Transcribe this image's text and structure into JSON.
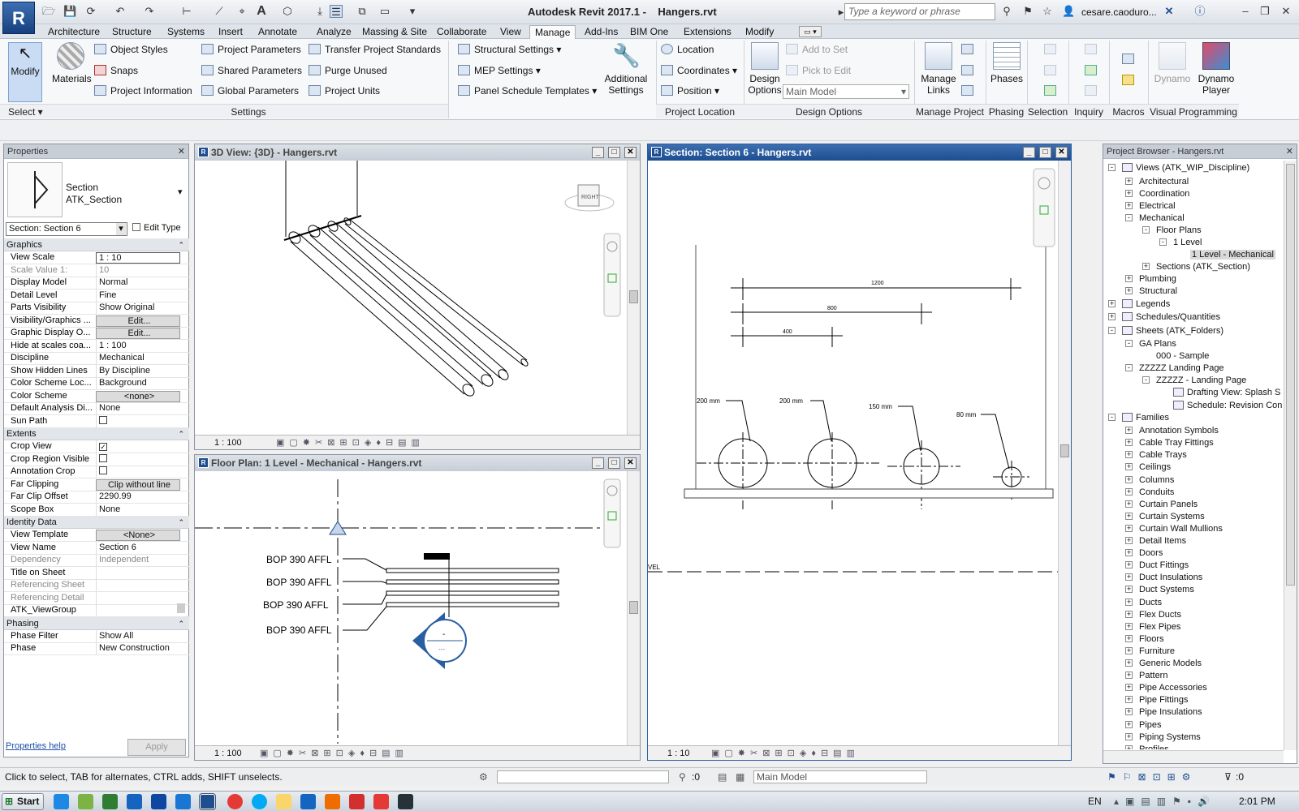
{
  "app": {
    "logo": "R",
    "title": "Autodesk Revit 2017.1 -    Hangers.rvt",
    "search_placeholder": "Type a keyword or phrase",
    "user": "cesare.caoduro..."
  },
  "tabs": [
    "Architecture",
    "Structure",
    "Systems",
    "Insert",
    "Annotate",
    "Analyze",
    "Massing & Site",
    "Collaborate",
    "View",
    "Manage",
    "Add-Ins",
    "BIM One",
    "Extensions",
    "Modify"
  ],
  "active_tab": "Manage",
  "ribbon": {
    "modify_label": "Modify",
    "materials_label": "Materials",
    "settings_col1": [
      "Object  Styles",
      "Snaps",
      "Project  Information"
    ],
    "settings_col2": [
      "Project  Parameters",
      "Shared  Parameters",
      "Global  Parameters"
    ],
    "settings_col3": [
      "Transfer  Project Standards",
      "Purge  Unused",
      "Project  Units"
    ],
    "mep_col": [
      "Structural  Settings",
      "MEP  Settings",
      "Panel Schedule  Templates"
    ],
    "additional_settings": "Additional Settings",
    "location_col": [
      "Location",
      "Coordinates",
      "Position"
    ],
    "design_options_label": "Design Options",
    "add_to_set": "Add to Set",
    "pick_to_edit": "Pick to Edit",
    "main_model": "Main Model",
    "manage_links": "Manage Links",
    "phases": "Phases",
    "dynamo": "Dynamo",
    "dynamo_player": "Dynamo Player",
    "panels": [
      "Select",
      "Settings",
      "Project Location",
      "Design Options",
      "Manage Project",
      "Phasing",
      "Selection",
      "Inquiry",
      "Macros",
      "Visual Programming"
    ]
  },
  "properties": {
    "title": "Properties",
    "type_name": "Section",
    "type_sub": "ATK_Section",
    "instance_selector": "Section: Section 6",
    "edit_type": "Edit Type",
    "groups": {
      "graphics": "Graphics",
      "extents": "Extents",
      "identity": "Identity Data",
      "phasing": "Phasing"
    },
    "graphics_rows": [
      [
        "View Scale",
        "1 : 10"
      ],
      [
        "Scale Value    1:",
        "10"
      ],
      [
        "Display Model",
        "Normal"
      ],
      [
        "Detail Level",
        "Fine"
      ],
      [
        "Parts Visibility",
        "Show Original"
      ],
      [
        "Visibility/Graphics ...",
        "Edit..."
      ],
      [
        "Graphic Display O...",
        "Edit..."
      ],
      [
        "Hide at scales coa...",
        "1 : 100"
      ],
      [
        "Discipline",
        "Mechanical"
      ],
      [
        "Show Hidden Lines",
        "By Discipline"
      ],
      [
        "Color Scheme Loc...",
        "Background"
      ],
      [
        "Color Scheme",
        "<none>"
      ],
      [
        "Default Analysis Di...",
        "None"
      ],
      [
        "Sun Path",
        ""
      ]
    ],
    "extents_rows": [
      [
        "Crop View",
        "checked"
      ],
      [
        "Crop Region Visible",
        ""
      ],
      [
        "Annotation Crop",
        ""
      ],
      [
        "Far Clipping",
        "Clip without line"
      ],
      [
        "Far Clip Offset",
        "2290.99"
      ],
      [
        "Scope Box",
        "None"
      ]
    ],
    "identity_rows": [
      [
        "View Template",
        "<None>"
      ],
      [
        "View Name",
        "Section 6"
      ],
      [
        "Dependency",
        "Independent"
      ],
      [
        "Title on Sheet",
        ""
      ],
      [
        "Referencing Sheet",
        ""
      ],
      [
        "Referencing Detail",
        ""
      ],
      [
        "ATK_ViewGroup",
        ""
      ]
    ],
    "phasing_rows": [
      [
        "Phase Filter",
        "Show All"
      ],
      [
        "Phase",
        "New Construction"
      ]
    ],
    "help_link": "Properties help",
    "apply": "Apply"
  },
  "views": {
    "v3d": {
      "title": "3D View: {3D} - Hangers.rvt",
      "scale": "1 : 100",
      "cube": "RIGHT"
    },
    "floor": {
      "title": "Floor Plan: 1 Level - Mechanical - Hangers.rvt",
      "scale": "1 : 100",
      "labels": [
        "BOP 390 AFFL",
        "BOP 390 AFFL",
        "BOP 390 AFFL",
        "BOP 390 AFFL"
      ],
      "tag_top": "-",
      "tag_bottom": "---"
    },
    "section": {
      "title": "Section: Section 6 - Hangers.rvt",
      "scale": "1 : 10",
      "dims": [
        "1200",
        "800",
        "400"
      ],
      "pipes": [
        "200 mm",
        "200 mm",
        "150 mm",
        "80 mm"
      ],
      "level": "VEL"
    }
  },
  "browser": {
    "title": "Project Browser - Hangers.rvt",
    "nodes": [
      {
        "t": "Views (ATK_WIP_Discipline)",
        "d": 0,
        "x": "-",
        "i": 1
      },
      {
        "t": "Architectural",
        "d": 1,
        "x": "+"
      },
      {
        "t": "Coordination",
        "d": 1,
        "x": "+"
      },
      {
        "t": "Electrical",
        "d": 1,
        "x": "+"
      },
      {
        "t": "Mechanical",
        "d": 1,
        "x": "-"
      },
      {
        "t": "Floor Plans",
        "d": 2,
        "x": "-"
      },
      {
        "t": "1 Level",
        "d": 3,
        "x": "-"
      },
      {
        "t": "1 Level - Mechanical",
        "d": 4,
        "x": "",
        "sel": 1
      },
      {
        "t": "Sections (ATK_Section)",
        "d": 2,
        "x": "+"
      },
      {
        "t": "Plumbing",
        "d": 1,
        "x": "+"
      },
      {
        "t": "Structural",
        "d": 1,
        "x": "+"
      },
      {
        "t": "Legends",
        "d": 0,
        "x": "+",
        "i": 1
      },
      {
        "t": "Schedules/Quantities",
        "d": 0,
        "x": "+",
        "i": 1
      },
      {
        "t": "Sheets (ATK_Folders)",
        "d": 0,
        "x": "-",
        "i": 1
      },
      {
        "t": "GA Plans",
        "d": 1,
        "x": "-"
      },
      {
        "t": "000 - Sample",
        "d": 2,
        "x": ""
      },
      {
        "t": "ZZZZZ Landing Page",
        "d": 1,
        "x": "-"
      },
      {
        "t": "ZZZZZ - Landing Page",
        "d": 2,
        "x": "-"
      },
      {
        "t": "Drafting View: Splash S",
        "d": 3,
        "x": "",
        "i": 1
      },
      {
        "t": "Schedule: Revision Con",
        "d": 3,
        "x": "",
        "i": 1
      },
      {
        "t": "Families",
        "d": 0,
        "x": "-",
        "i": 1
      },
      {
        "t": "Annotation Symbols",
        "d": 1,
        "x": "+"
      },
      {
        "t": "Cable Tray Fittings",
        "d": 1,
        "x": "+"
      },
      {
        "t": "Cable Trays",
        "d": 1,
        "x": "+"
      },
      {
        "t": "Ceilings",
        "d": 1,
        "x": "+"
      },
      {
        "t": "Columns",
        "d": 1,
        "x": "+"
      },
      {
        "t": "Conduits",
        "d": 1,
        "x": "+"
      },
      {
        "t": "Curtain Panels",
        "d": 1,
        "x": "+"
      },
      {
        "t": "Curtain Systems",
        "d": 1,
        "x": "+"
      },
      {
        "t": "Curtain Wall Mullions",
        "d": 1,
        "x": "+"
      },
      {
        "t": "Detail Items",
        "d": 1,
        "x": "+"
      },
      {
        "t": "Doors",
        "d": 1,
        "x": "+"
      },
      {
        "t": "Duct Fittings",
        "d": 1,
        "x": "+"
      },
      {
        "t": "Duct Insulations",
        "d": 1,
        "x": "+"
      },
      {
        "t": "Duct Systems",
        "d": 1,
        "x": "+"
      },
      {
        "t": "Ducts",
        "d": 1,
        "x": "+"
      },
      {
        "t": "Flex Ducts",
        "d": 1,
        "x": "+"
      },
      {
        "t": "Flex Pipes",
        "d": 1,
        "x": "+"
      },
      {
        "t": "Floors",
        "d": 1,
        "x": "+"
      },
      {
        "t": "Furniture",
        "d": 1,
        "x": "+"
      },
      {
        "t": "Generic Models",
        "d": 1,
        "x": "+"
      },
      {
        "t": "Pattern",
        "d": 1,
        "x": "+"
      },
      {
        "t": "Pipe Accessories",
        "d": 1,
        "x": "+"
      },
      {
        "t": "Pipe Fittings",
        "d": 1,
        "x": "+"
      },
      {
        "t": "Pipe Insulations",
        "d": 1,
        "x": "+"
      },
      {
        "t": "Pipes",
        "d": 1,
        "x": "+"
      },
      {
        "t": "Piping Systems",
        "d": 1,
        "x": "+"
      },
      {
        "t": "Profiles",
        "d": 1,
        "x": "+"
      }
    ]
  },
  "status": {
    "hint": "Click to select, TAB for alternates, CTRL adds, SHIFT unselects.",
    "count1": ":0",
    "model": "Main Model",
    "filter_count": ":0"
  },
  "taskbar": {
    "start": "Start",
    "lang": "EN",
    "clock": "2:01 PM"
  },
  "colors": {
    "accent": "#1f4e8f",
    "tab_active": "#fbfbfb",
    "view_active": "#2a5ea3"
  }
}
